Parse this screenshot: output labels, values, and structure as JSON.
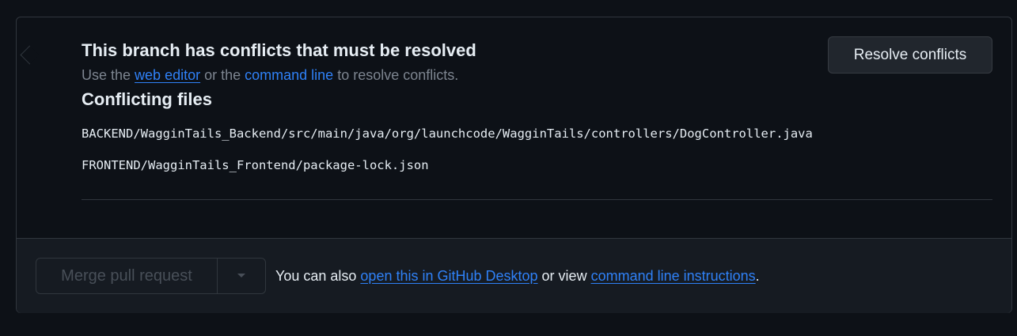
{
  "header": {
    "title": "This branch has conflicts that must be resolved",
    "subtitle_prefix": "Use the ",
    "web_editor_link": "web editor",
    "subtitle_mid": " or the ",
    "command_line_link": "command line",
    "subtitle_suffix": " to resolve conflicts."
  },
  "resolve_button": {
    "label": "Resolve conflicts"
  },
  "conflicts": {
    "heading": "Conflicting files",
    "files": [
      "BACKEND/WagginTails_Backend/src/main/java/org/launchcode/WagginTails/controllers/DogController.java",
      "FRONTEND/WagginTails_Frontend/package-lock.json"
    ]
  },
  "merge": {
    "button_label": "Merge pull request",
    "text_prefix": "You can also ",
    "desktop_link": "open this in GitHub Desktop",
    "text_mid": " or view ",
    "instructions_link": "command line instructions",
    "text_suffix": "."
  },
  "icons": {
    "status": "alert-icon",
    "caret": "triangle-down-icon"
  },
  "colors": {
    "background": "#0d1117",
    "border": "#30363d",
    "link": "#2f81f7",
    "muted": "#7d8590",
    "status_icon_bg": "#6e7681"
  }
}
